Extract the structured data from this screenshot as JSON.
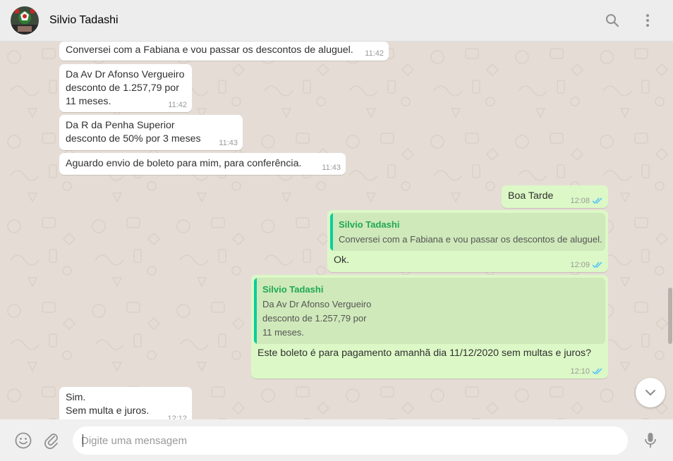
{
  "header": {
    "contact_name": "Silvio Tadashi",
    "icons": [
      "avatar",
      "search-icon",
      "menu-icon"
    ]
  },
  "messages": [
    {
      "id": "m1",
      "dir": "in",
      "text": "Conversei com a Fabiana e vou passar os descontos de aluguel.",
      "time": "11:42"
    },
    {
      "id": "m2",
      "dir": "in",
      "text": "Da Av Dr Afonso Vergueiro\ndesconto de 1.257,79 por\n11 meses.",
      "time": "11:42"
    },
    {
      "id": "m3",
      "dir": "in",
      "text": "Da R da Penha Superior\ndesconto de 50% por 3 meses",
      "time": "11:43"
    },
    {
      "id": "m4",
      "dir": "in",
      "text": "Aguardo envio de boleto para mim, para conferência.",
      "time": "11:43"
    },
    {
      "id": "m5",
      "dir": "out",
      "text": "Boa Tarde",
      "time": "12:08",
      "status": "read"
    },
    {
      "id": "m6",
      "dir": "out",
      "text": "Ok.",
      "time": "12:09",
      "status": "read",
      "quote": {
        "name": "Silvio Tadashi",
        "text": "Conversei com a Fabiana e vou passar os descontos de aluguel."
      }
    },
    {
      "id": "m7",
      "dir": "out",
      "text": "Este boleto é para pagamento amanhã dia 11/12/2020 sem multas e juros?",
      "time": "12:10",
      "status": "read",
      "quote": {
        "name": "Silvio Tadashi",
        "text": "Da Av Dr Afonso Vergueiro\ndesconto de 1.257,79 por\n11 meses."
      }
    },
    {
      "id": "m8",
      "dir": "in",
      "text": "Sim.\nSem multa e juros.",
      "time": "12:12"
    }
  ],
  "composer": {
    "placeholder": "Digite uma mensagem",
    "value": ""
  },
  "colors": {
    "incoming_bubble": "#ffffff",
    "outgoing_bubble": "#dcf8c6",
    "quote_accent": "#06cf9c",
    "quote_name": "#1fa855",
    "read_ticks": "#4fc3f7",
    "chat_background": "#e5ddd5"
  }
}
